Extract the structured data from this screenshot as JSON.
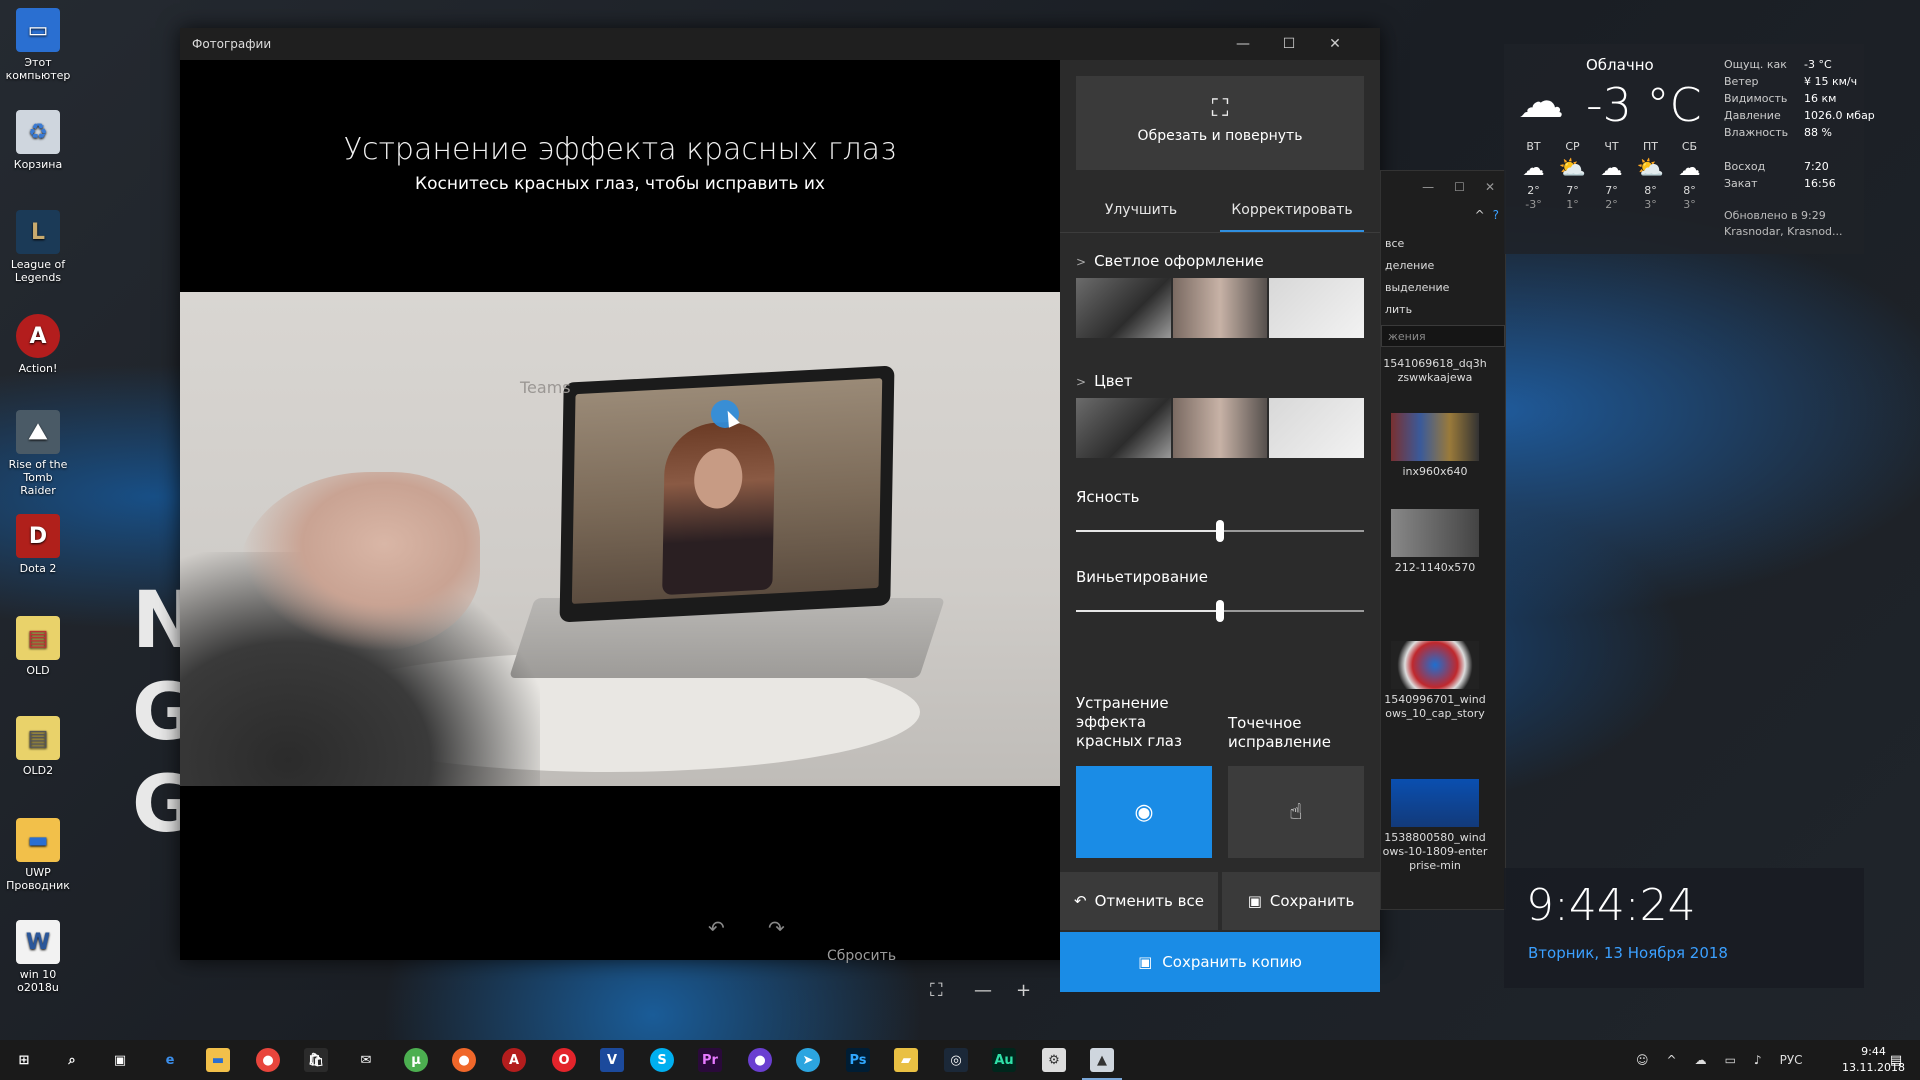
{
  "desktop": {
    "icons": [
      {
        "label": "Этот компьютер"
      },
      {
        "label": "Корзина"
      },
      {
        "label": "League of Legends"
      },
      {
        "label": "Action!"
      },
      {
        "label": "Rise of the Tomb Raider"
      },
      {
        "label": "Dota 2"
      },
      {
        "label": "OLD"
      },
      {
        "label": "OLD2"
      },
      {
        "label": "UWP Проводник"
      },
      {
        "label": "win 10 o2018u"
      }
    ]
  },
  "photos_window": {
    "title": "Фотографии",
    "headline": "Устранение эффекта красных глаз",
    "subline": "Коснитесь красных глаз, чтобы исправить их",
    "photo_caption": "Teams",
    "reset_label": "Сбросить"
  },
  "panel": {
    "crop_label": "Обрезать и повернуть",
    "tab_enhance": "Улучшить",
    "tab_adjust": "Корректировать",
    "light_title": "Светлое оформление",
    "color_title": "Цвет",
    "clarity_label": "Ясность",
    "clarity_value": 0.5,
    "vignette_label": "Виньетирование",
    "vignette_value": 0.5,
    "redeye_label": "Устранение эффекта красных глаз",
    "spotfix_label": "Точечное исправление",
    "undo_all_label": "Отменить все",
    "save_label": "Сохранить",
    "save_copy_label": "Сохранить копию"
  },
  "explorer": {
    "menu": [
      "все",
      "деление",
      "выделение",
      "лить"
    ],
    "search_placeholder": "жения",
    "files": [
      {
        "name": "1541069618_dq3hzswwkaajewa"
      },
      {
        "name": "inx960x640"
      },
      {
        "name": "212-1140x570"
      },
      {
        "name": "1540996701_windows_10_cap_story"
      },
      {
        "name": "1538800580_windows-10-1809-enterprise-min"
      }
    ]
  },
  "weather": {
    "condition": "Облачно",
    "temperature": "-3 °C",
    "feels_label": "Ощущ. как",
    "feels_value": "-3 °C",
    "wind_label": "Ветер",
    "wind_value": "¥ 15 км/ч",
    "visibility_label": "Видимость",
    "visibility_value": "16 км",
    "pressure_label": "Давление",
    "pressure_value": "1026.0 мбар",
    "humidity_label": "Влажность",
    "humidity_value": "88 %",
    "sunrise_label": "Восход",
    "sunrise_value": "7:20",
    "sunset_label": "Закат",
    "sunset_value": "16:56",
    "updated": "Обновлено в 9:29",
    "location": "Krasnodar, Krasnod...",
    "forecast": [
      {
        "day": "ВТ",
        "hi": "2°",
        "lo": "-3°"
      },
      {
        "day": "СР",
        "hi": "7°",
        "lo": "1°"
      },
      {
        "day": "ЧТ",
        "hi": "7°",
        "lo": "2°"
      },
      {
        "day": "ПТ",
        "hi": "8°",
        "lo": "3°"
      },
      {
        "day": "СБ",
        "hi": "8°",
        "lo": "3°"
      }
    ]
  },
  "clock": {
    "time": "9:44:24",
    "date": "Вторник, 13 Ноября 2018"
  },
  "taskbar": {
    "language": "РУС",
    "time": "9:44",
    "date": "13.11.2018"
  },
  "colors": {
    "accent": "#1a8ce6",
    "panel_bg": "#2b2b2b"
  }
}
